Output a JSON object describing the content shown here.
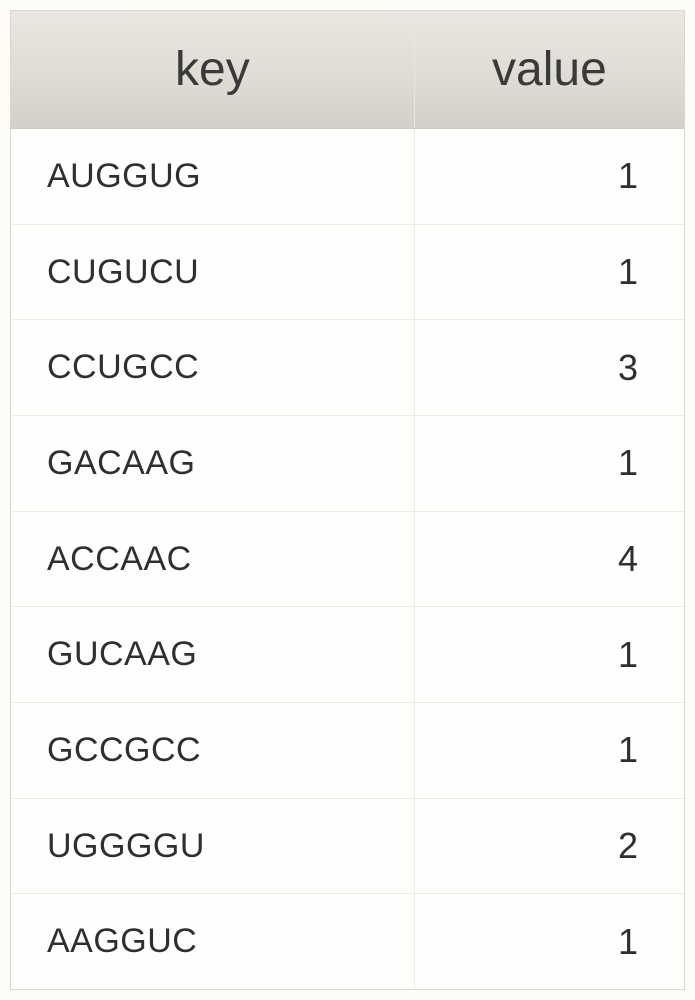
{
  "table": {
    "headers": {
      "key": "key",
      "value": "value"
    },
    "rows": [
      {
        "key": "AUGGUG",
        "value": 1
      },
      {
        "key": "CUGUCU",
        "value": 1
      },
      {
        "key": "CCUGCC",
        "value": 3
      },
      {
        "key": "GACAAG",
        "value": 1
      },
      {
        "key": "ACCAAC",
        "value": 4
      },
      {
        "key": "GUCAAG",
        "value": 1
      },
      {
        "key": "GCCGCC",
        "value": 1
      },
      {
        "key": "UGGGGU",
        "value": 2
      },
      {
        "key": "AAGGUC",
        "value": 1
      }
    ]
  }
}
